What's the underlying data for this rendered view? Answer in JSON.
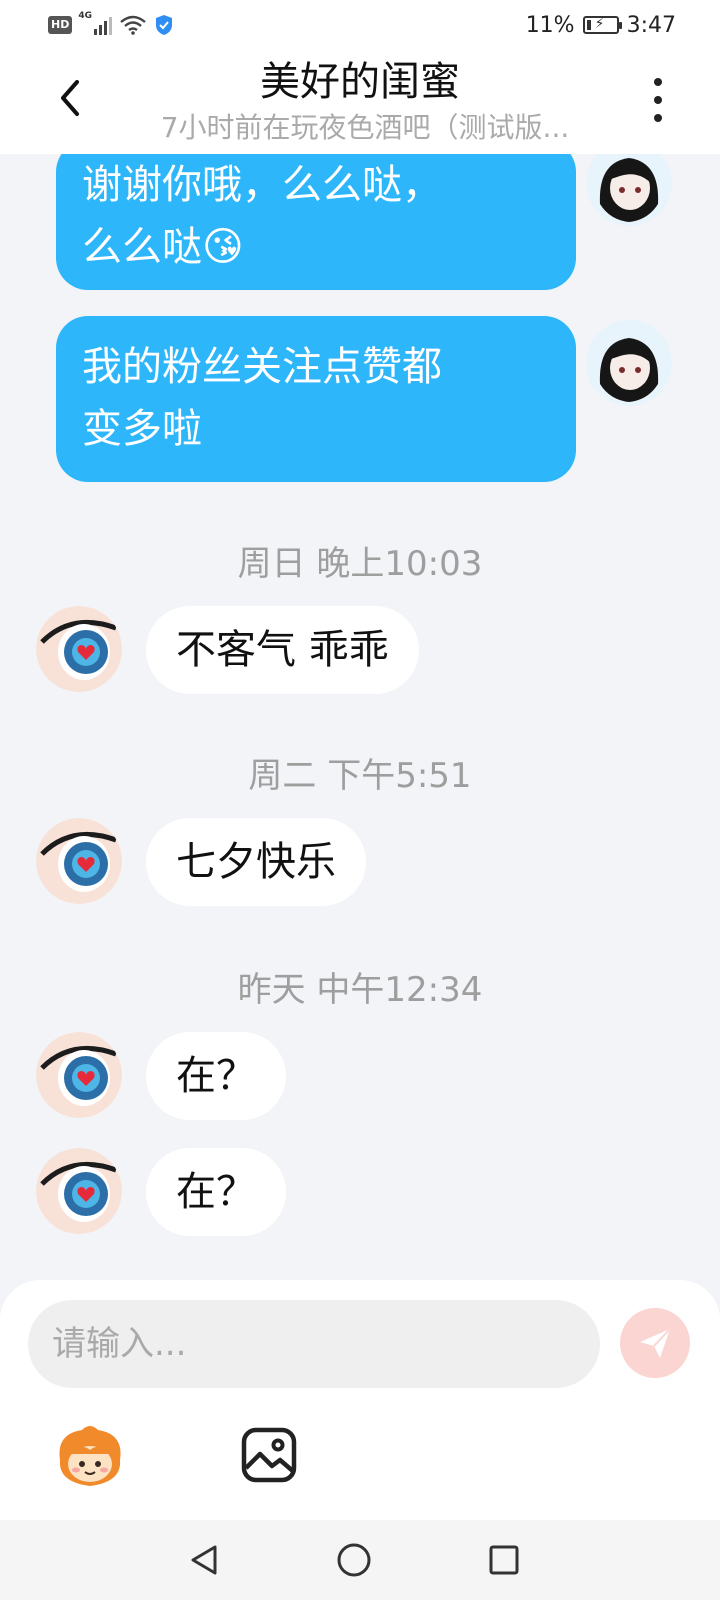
{
  "status_bar": {
    "hd_badge": "HD",
    "network": "4G",
    "battery_percent": "11%",
    "time": "3:47"
  },
  "header": {
    "title": "美好的闺蜜",
    "subtitle": "7小时前在玩夜色酒吧（测试版..."
  },
  "messages_out": [
    {
      "lines": [
        "谢谢你哦，么么哒，",
        "么么哒😘"
      ]
    },
    {
      "lines": [
        "我的粉丝关注点赞都",
        "变多啦"
      ]
    }
  ],
  "timestamps": [
    "周日 晚上10:03",
    "周二 下午5:51",
    "昨天 中午12:34"
  ],
  "messages_in": [
    "不客气 乖乖",
    "七夕快乐",
    "在？",
    "在？"
  ],
  "input": {
    "placeholder": "请输入..."
  },
  "icons": {
    "back": "chevron-left-icon",
    "more": "vertical-ellipsis-icon",
    "send": "paper-plane-icon",
    "sticker": "sticker-face-icon",
    "image": "image-icon",
    "nav_back": "triangle-back-icon",
    "nav_home": "circle-home-icon",
    "nav_recent": "square-recent-icon"
  },
  "colors": {
    "outgoing_bubble": "#2eb6fb",
    "incoming_bubble": "#ffffff",
    "chat_background": "#f2f4f7",
    "send_button": "#fbd5d2",
    "timestamp_text": "#9e9e9e"
  }
}
